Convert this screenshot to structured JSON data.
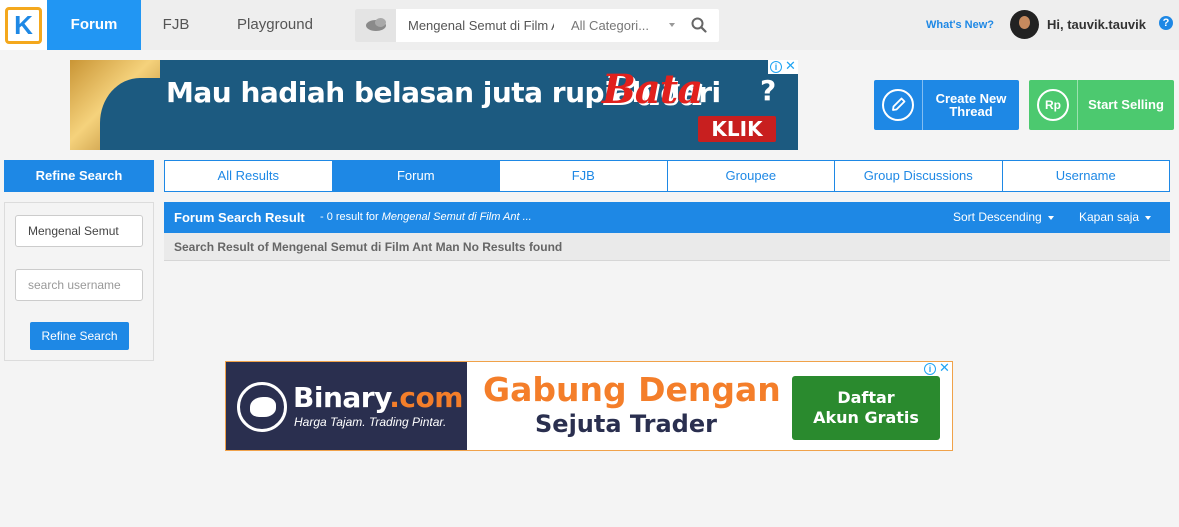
{
  "topbar": {
    "logo_letter": "K",
    "nav": [
      {
        "label": "Forum"
      },
      {
        "label": "FJB"
      },
      {
        "label": "Playground"
      }
    ],
    "search": {
      "value": "Mengenal Semut di Film Ant Man",
      "category": "All Categori..."
    },
    "whats_new": "What's New?",
    "greeting": "Hi, tauvik.tauvik",
    "help": "?"
  },
  "banner_ad": {
    "text": "Mau hadiah belasan juta rupiah dari",
    "brand": "Bata",
    "qmark": "?",
    "cta": "KLIK"
  },
  "actions": {
    "create_line1": "Create New",
    "create_line2": "Thread",
    "sell_icon": "Rp",
    "sell": "Start Selling"
  },
  "sidebar": {
    "title": "Refine Search",
    "query_value": "Mengenal Semut",
    "username_placeholder": "search username",
    "button": "Refine Search"
  },
  "tabs": [
    {
      "label": "All Results",
      "active": false
    },
    {
      "label": "Forum",
      "active": true
    },
    {
      "label": "FJB",
      "active": false
    },
    {
      "label": "Groupee",
      "active": false
    },
    {
      "label": "Group Discussions",
      "active": false
    },
    {
      "label": "Username",
      "active": false
    }
  ],
  "results": {
    "title": "Forum Search Result",
    "meta_prefix": "- 0 result for",
    "meta_query": "Mengenal Semut di Film Ant ...",
    "sort": "Sort Descending",
    "time": "Kapan saja",
    "message": "Search Result of Mengenal Semut di Film Ant Man No Results found"
  },
  "bottom_ad": {
    "brand_main": "Binary",
    "brand_suffix": ".com",
    "tagline": "Harga Tajam. Trading Pintar.",
    "headline": "Gabung Dengan",
    "subline": "Sejuta Trader",
    "cta_line1": "Daftar",
    "cta_line2": "Akun Gratis"
  },
  "colors": {
    "primary": "#1e88e5",
    "success": "#4cc96f",
    "accent": "#f4a81d"
  }
}
